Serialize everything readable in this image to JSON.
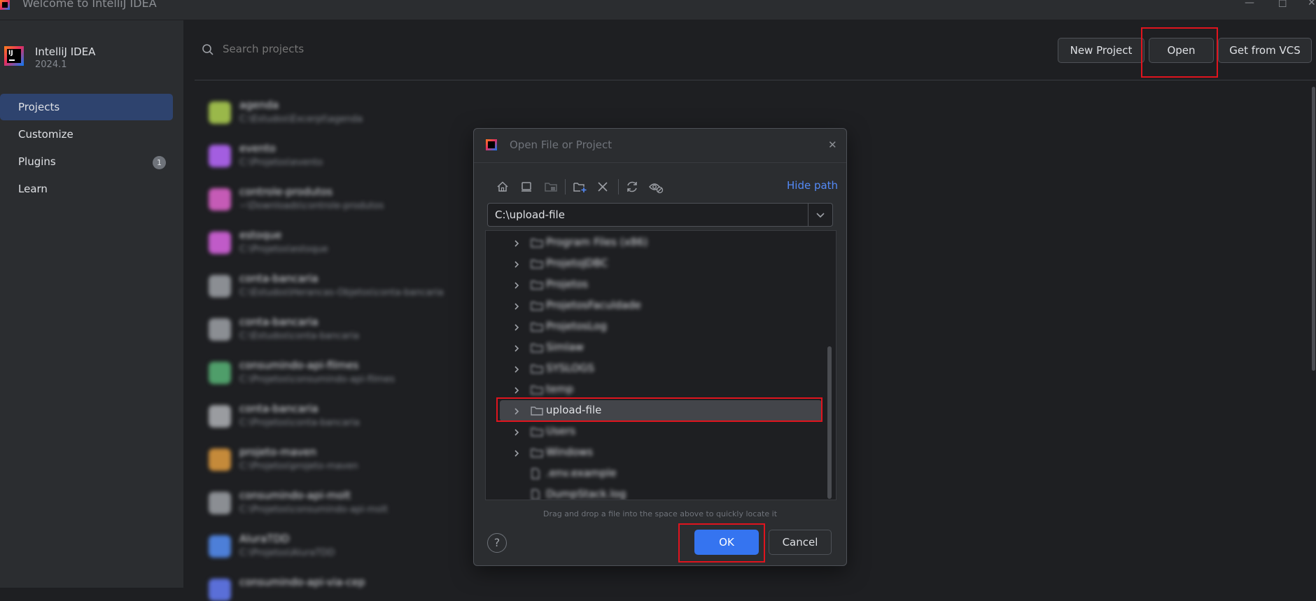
{
  "window": {
    "title": "Welcome to IntelliJ IDEA"
  },
  "app": {
    "name": "IntelliJ IDEA",
    "version": "2024.1",
    "logo_text": "IJ"
  },
  "sidebar": {
    "items": [
      {
        "label": "Projects",
        "selected": true
      },
      {
        "label": "Customize"
      },
      {
        "label": "Plugins",
        "badge": "1"
      },
      {
        "label": "Learn"
      }
    ]
  },
  "header": {
    "search_placeholder": "Search projects",
    "new_project_label": "New Project",
    "open_label": "Open",
    "vcs_label": "Get from VCS"
  },
  "projects": [
    {
      "name": "agenda",
      "path": "C:\\Estudos\\Excerpt\\agenda",
      "color": "#9ab84a"
    },
    {
      "name": "evento",
      "path": "C:\\Projetos\\evento",
      "color": "#a35ee0"
    },
    {
      "name": "controle-produtos",
      "path": "~\\Downloads\\controle-produtos",
      "color": "#c55bb6"
    },
    {
      "name": "estoque",
      "path": "C:\\Projetos\\estoque",
      "color": "#c05bc8"
    },
    {
      "name": "conta-bancaria",
      "path": "C:\\Estudos\\Herancas-Objetos\\conta-bancaria",
      "color": "#8b8e93"
    },
    {
      "name": "conta-bancaria",
      "path": "C:\\Estudos\\conta-bancaria",
      "color": "#8b8e93"
    },
    {
      "name": "consumindo-api-filmes",
      "path": "C:\\Projetos\\consumindo-api-filmes",
      "color": "#4f9e6a"
    },
    {
      "name": "conta-bancaria",
      "path": "C:\\Projetos\\conta-bancaria",
      "color": "#9a9ca0"
    },
    {
      "name": "projeto-maven",
      "path": "C:\\Projetos\\projeto-maven",
      "color": "#c58a3a"
    },
    {
      "name": "consumindo-api-molt",
      "path": "C:\\Projetos\\consumindo-api-molt",
      "color": "#8b8e93"
    },
    {
      "name": "AluraTDD",
      "path": "C:\\Projetos\\AluraTDD",
      "color": "#4d7fd8"
    },
    {
      "name": "consumindo-api-via-cep",
      "path": "",
      "color": "#5a6fd8"
    }
  ],
  "dialog": {
    "title": "Open File or Project",
    "logo_text": "IJ",
    "hide_path_label": "Hide path",
    "path_value": "C:\\upload-file",
    "tree_rows": [
      {
        "name": "Program Files (x86)",
        "type": "folder",
        "expandable": true
      },
      {
        "name": "ProjetoJDBC",
        "type": "folder",
        "expandable": true
      },
      {
        "name": "Projetos",
        "type": "folder",
        "expandable": true
      },
      {
        "name": "ProjetosFaculdade",
        "type": "folder",
        "expandable": true
      },
      {
        "name": "ProjetosLog",
        "type": "folder",
        "expandable": true
      },
      {
        "name": "Simlaw",
        "type": "folder",
        "expandable": true
      },
      {
        "name": "SYSLOGS",
        "type": "folder",
        "expandable": true
      },
      {
        "name": "temp",
        "type": "folder",
        "expandable": true
      },
      {
        "name": "upload-file",
        "type": "folder",
        "expandable": true,
        "selected": true
      },
      {
        "name": "Users",
        "type": "folder",
        "expandable": true
      },
      {
        "name": "Windows",
        "type": "folder",
        "expandable": true
      },
      {
        "name": ".env.example",
        "type": "file",
        "expandable": false
      },
      {
        "name": "DumpStack.log",
        "type": "file",
        "expandable": false
      }
    ],
    "hint": "Drag and drop a file into the space above to quickly locate it",
    "help_label": "?",
    "ok_label": "OK",
    "cancel_label": "Cancel"
  },
  "colors": {
    "accent": "#3574f0",
    "link": "#548af7",
    "selection": "#2e436e",
    "highlight": "#e0141e"
  }
}
